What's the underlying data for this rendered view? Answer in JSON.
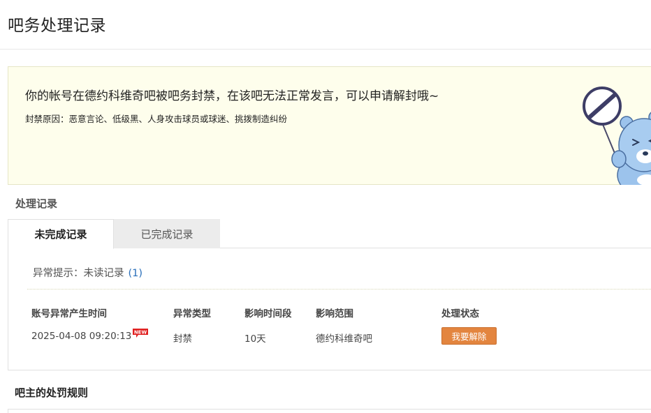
{
  "page": {
    "title": "吧务处理记录"
  },
  "notice": {
    "message": "你的帐号在德约科维奇吧被吧务封禁，在该吧无法正常发言，可以申请解封哦~",
    "reason_label": "封禁原因：",
    "reason_text": "恶意言论、低级黑、人身攻击球员或球迷、挑拨制造纠纷"
  },
  "records": {
    "section_title": "处理记录",
    "tabs": [
      {
        "label": "未完成记录",
        "active": true
      },
      {
        "label": "已完成记录",
        "active": false
      }
    ],
    "alert_label": "异常提示：未读记录",
    "alert_count": "(1)",
    "columns": [
      "账号异常产生时间",
      "异常类型",
      "影响时间段",
      "影响范围",
      "处理状态"
    ],
    "rows": [
      {
        "time": "2025-04-08 09:20:13",
        "new_badge": "NEW",
        "type": "封禁",
        "duration": "10天",
        "scope": "德约科维奇吧",
        "action_label": "我要解除"
      }
    ]
  },
  "rules": {
    "section_title": "吧主的处罚规则"
  },
  "colors": {
    "notice_bg": "#fefeec",
    "accent_button": "#e3853f",
    "link_blue": "#2a6fba",
    "badge_red": "#e02020"
  },
  "icons": {
    "mascot": "prohibited-sign-bear-icon",
    "badge": "new-badge-icon"
  }
}
